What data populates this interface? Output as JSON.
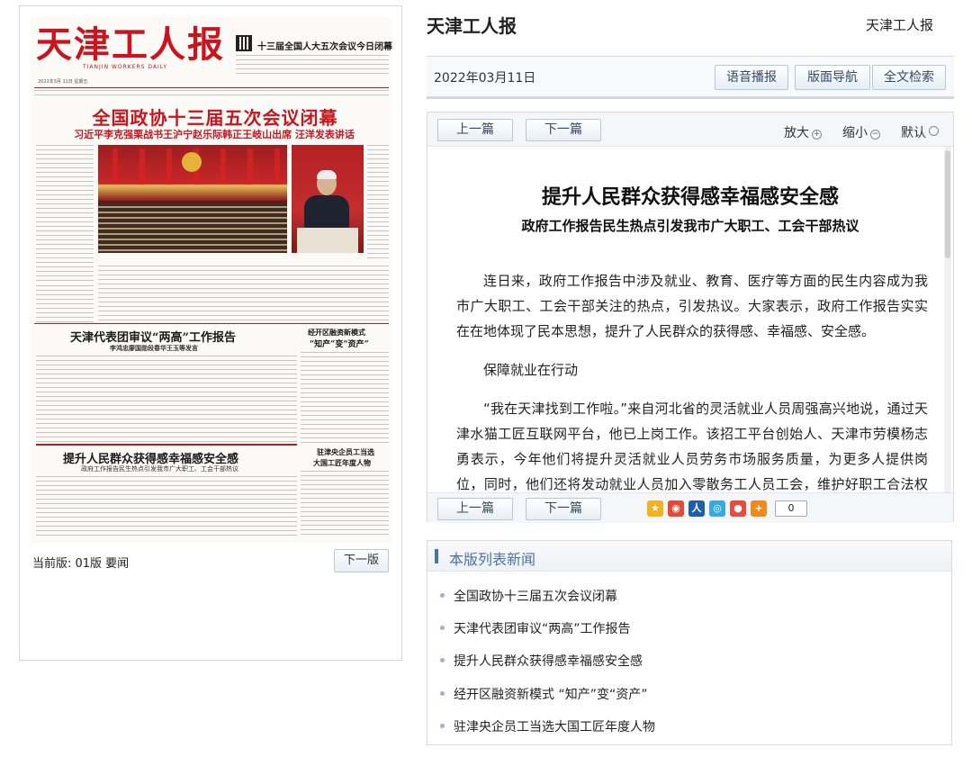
{
  "paper": {
    "masthead": "天津工人报",
    "masthead_sub": "TIANJIN WORKERS DAILY",
    "top_promo": "十三届全国人大五次会议今日闭幕",
    "date_issue": "2022年3月 11日 星期五",
    "headline": "全国政协十三届五次会议闭幕",
    "subheadline": "习近平李克强栗战书王沪宁赵乐际韩正王岐山出席 汪洋发表讲话",
    "story2_title": "天津代表团审议“两高”工作报告",
    "story2_sub": "李鸿忠廖国勋段春华王玉等发言",
    "story3_title": "经开区融资新模式",
    "story3_sub": "“知产”变“资产”",
    "story4_title": "提升人民群众获得感幸福感安全感",
    "story4_sub": "政府工作报告民生热点引发我市广大职工、工会干部热议",
    "story5_title": "驻津央企员工当选",
    "story5_sub": "大国工匠年度人物",
    "current_page_label": "当前版: 01版 要闻",
    "next_page_button": "下一版"
  },
  "header": {
    "site_title": "天津工人报",
    "site_title_right": "天津工人报"
  },
  "toolbar": {
    "date": "2022年03月11日",
    "voice_button": "语音播报",
    "nav_button": "版面导航",
    "search_button": "全文检索"
  },
  "article_nav": {
    "prev": "上一篇",
    "next": "下一篇",
    "zoom_in": "放大",
    "zoom_out": "缩小",
    "default": "默认"
  },
  "article": {
    "title": "提升人民群众获得感幸福感安全感",
    "subtitle": "政府工作报告民生热点引发我市广大职工、工会干部热议",
    "paragraphs": [
      "连日来，政府工作报告中涉及就业、教育、医疗等方面的民生内容成为我市广大职工、工会干部关注的热点，引发热议。大家表示，政府工作报告实实在在地体现了民本思想，提升了人民群众的获得感、幸福感、安全感。",
      "保障就业在行动",
      "“我在天津找到工作啦。”来自河北省的灵活就业人员周强高兴地说，通过天津水猫工匠互联网平台，他已上岗工作。该招工平台创始人、天津市劳模杨志勇表示，今年他们将提升灵活就业人员劳务市场服务质量，为更多人提供岗位，同时，他们还将发动就业人员加入零散务工人员工会，维护好职工合法权益，让他"
    ],
    "share_count": "0"
  },
  "share_icons": [
    "qzone-icon",
    "weibo-icon",
    "renren-icon",
    "kaixin-icon",
    "wechat-icon",
    "more-share-icon"
  ],
  "page_list": {
    "title": "本版列表新闻",
    "items": [
      "全国政协十三届五次会议闭幕",
      "天津代表团审议“两高”工作报告",
      "提升人民群众获得感幸福感安全感",
      "经开区融资新模式 “知产”变“资产”",
      "驻津央企员工当选大国工匠年度人物"
    ]
  },
  "colors": {
    "masthead_red": "#c9151e",
    "link_blue": "#4a73a8"
  }
}
